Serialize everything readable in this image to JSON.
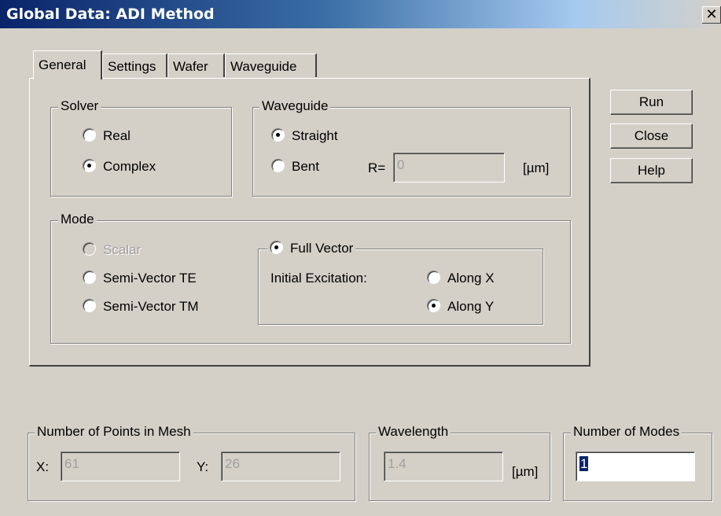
{
  "window": {
    "title": "Global Data: ADI Method",
    "close_glyph": "✕"
  },
  "tabs": [
    "General",
    "Settings",
    "Wafer",
    "Waveguide"
  ],
  "active_tab": "General",
  "solver": {
    "label": "Solver",
    "options": [
      {
        "label": "Real",
        "checked": false
      },
      {
        "label": "Complex",
        "checked": true
      }
    ]
  },
  "waveguide": {
    "label": "Waveguide",
    "options": [
      {
        "label": "Straight",
        "checked": true
      },
      {
        "label": "Bent",
        "checked": false
      }
    ],
    "radius_label": "R=",
    "radius_value": "0",
    "radius_unit": "[µm]"
  },
  "mode": {
    "label": "Mode",
    "options": [
      {
        "label": "Scalar",
        "checked": false,
        "disabled": true
      },
      {
        "label": "Semi-Vector TE",
        "checked": false
      },
      {
        "label": "Semi-Vector TM",
        "checked": false
      }
    ],
    "full_vector": {
      "label": "Full Vector",
      "checked": true,
      "excitation_label": "Initial Excitation:",
      "options": [
        {
          "label": "Along X",
          "checked": false
        },
        {
          "label": "Along Y",
          "checked": true
        }
      ]
    }
  },
  "buttons": {
    "run": "Run",
    "close": "Close",
    "help": "Help"
  },
  "mesh": {
    "label": "Number of Points in Mesh",
    "x_label": "X:",
    "x_value": "61",
    "y_label": "Y:",
    "y_value": "26"
  },
  "wavelength": {
    "label": "Wavelength",
    "value": "1.4",
    "unit": "[µm]"
  },
  "modes": {
    "label": "Number of Modes",
    "value": "1"
  }
}
